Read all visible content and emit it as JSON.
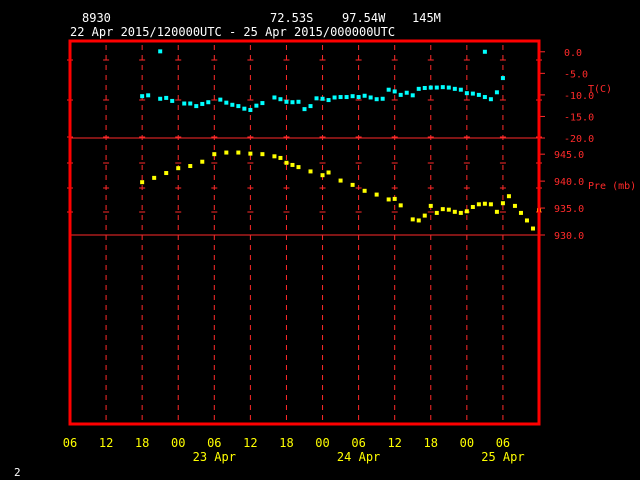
{
  "header": {
    "station_id": "8930",
    "lat": "72.53S",
    "lon": "97.54W",
    "elev": "145M",
    "period": "22 Apr 2015/120000UTC - 25 Apr 2015/000000UTC"
  },
  "footer": {
    "page": "2"
  },
  "colors": {
    "frame": "#ff0000",
    "grid": "#ff2a2a",
    "temp": "#00ffff",
    "pressure": "#ffff00",
    "axis_text": "#ffff00",
    "background": "#000000"
  },
  "chart_data": [
    {
      "type": "scatter",
      "series_label": "T(C)",
      "ylim": [
        -20,
        2.5
      ],
      "y_ticks": [
        "0.0",
        "-5.0",
        "-10.0",
        "-15.0",
        "-20.0"
      ],
      "x_unit": "hours since 22 Apr 2015 06 UTC",
      "points": [
        [
          12,
          -10.3
        ],
        [
          13,
          -10.1
        ],
        [
          15,
          -10.9
        ],
        [
          16,
          -10.7
        ],
        [
          17,
          -11.4
        ],
        [
          19,
          -12.0
        ],
        [
          20,
          -12.0
        ],
        [
          21,
          -12.6
        ],
        [
          22,
          -12.1
        ],
        [
          23,
          -11.7
        ],
        [
          25,
          -11.1
        ],
        [
          26,
          -11.8
        ],
        [
          27,
          -12.3
        ],
        [
          28,
          -12.6
        ],
        [
          29,
          -13.2
        ],
        [
          30,
          -13.5
        ],
        [
          31,
          -12.5
        ],
        [
          32,
          -11.9
        ],
        [
          34,
          -10.6
        ],
        [
          35,
          -11.0
        ],
        [
          36,
          -11.6
        ],
        [
          37,
          -11.7
        ],
        [
          38,
          -11.6
        ],
        [
          39,
          -13.3
        ],
        [
          40,
          -12.6
        ],
        [
          41,
          -10.8
        ],
        [
          42,
          -10.9
        ],
        [
          43,
          -11.2
        ],
        [
          44,
          -10.6
        ],
        [
          45,
          -10.5
        ],
        [
          46,
          -10.5
        ],
        [
          47,
          -10.3
        ],
        [
          48,
          -10.5
        ],
        [
          49,
          -10.2
        ],
        [
          50,
          -10.6
        ],
        [
          51,
          -11.0
        ],
        [
          52,
          -10.9
        ],
        [
          53,
          -8.8
        ],
        [
          54,
          -9.2
        ],
        [
          55,
          -10.0
        ],
        [
          56,
          -9.5
        ],
        [
          57,
          -10.1
        ],
        [
          58,
          -8.6
        ],
        [
          59,
          -8.4
        ],
        [
          60,
          -8.3
        ],
        [
          61,
          -8.3
        ],
        [
          62,
          -8.2
        ],
        [
          63,
          -8.3
        ],
        [
          64,
          -8.6
        ],
        [
          65,
          -8.8
        ],
        [
          66,
          -9.6
        ],
        [
          67,
          -9.7
        ],
        [
          68,
          -10.0
        ],
        [
          69,
          -10.5
        ],
        [
          70,
          -11.0
        ],
        [
          71,
          -9.4
        ],
        [
          72,
          -6.1
        ],
        [
          15,
          0.1
        ],
        [
          69,
          0.0
        ]
      ]
    },
    {
      "type": "scatter",
      "series_label": "Pre (mb)",
      "ylim": [
        930,
        948
      ],
      "y_ticks": [
        "945.0",
        "940.0",
        "935.0",
        "930.0"
      ],
      "x_unit": "hours since 22 Apr 2015 06 UTC",
      "points": [
        [
          12,
          939.8
        ],
        [
          14,
          940.6
        ],
        [
          16,
          941.5
        ],
        [
          18,
          942.4
        ],
        [
          20,
          942.8
        ],
        [
          22,
          943.6
        ],
        [
          24,
          945.0
        ],
        [
          26,
          945.3
        ],
        [
          28,
          945.3
        ],
        [
          30,
          945.1
        ],
        [
          32,
          945.0
        ],
        [
          34,
          944.6
        ],
        [
          35,
          944.3
        ],
        [
          36,
          943.4
        ],
        [
          37,
          943.0
        ],
        [
          38,
          942.6
        ],
        [
          40,
          941.8
        ],
        [
          42,
          941.1
        ],
        [
          43,
          941.6
        ],
        [
          45,
          940.1
        ],
        [
          47,
          939.3
        ],
        [
          49,
          938.2
        ],
        [
          51,
          937.5
        ],
        [
          53,
          936.6
        ],
        [
          54,
          936.7
        ],
        [
          55,
          935.5
        ],
        [
          57,
          932.9
        ],
        [
          58,
          932.7
        ],
        [
          59,
          933.6
        ],
        [
          60,
          935.4
        ],
        [
          61,
          934.1
        ],
        [
          62,
          934.8
        ],
        [
          63,
          934.7
        ],
        [
          64,
          934.3
        ],
        [
          65,
          934.1
        ],
        [
          66,
          934.4
        ],
        [
          67,
          935.2
        ],
        [
          68,
          935.7
        ],
        [
          69,
          935.8
        ],
        [
          70,
          935.7
        ],
        [
          71,
          934.3
        ],
        [
          72,
          935.9
        ],
        [
          73,
          937.2
        ],
        [
          74,
          935.4
        ],
        [
          75,
          934.1
        ],
        [
          76,
          932.7
        ],
        [
          77,
          931.2
        ],
        [
          78,
          934.6
        ]
      ]
    }
  ],
  "x_axis": {
    "hour_ticks": [
      "06",
      "12",
      "18",
      "00",
      "06",
      "12",
      "18",
      "00",
      "06",
      "12",
      "18",
      "00",
      "06"
    ],
    "date_labels": [
      {
        "text": "23 Apr",
        "at_hour": 24
      },
      {
        "text": "24 Apr",
        "at_hour": 48
      },
      {
        "text": "25 Apr",
        "at_hour": 72
      }
    ]
  }
}
